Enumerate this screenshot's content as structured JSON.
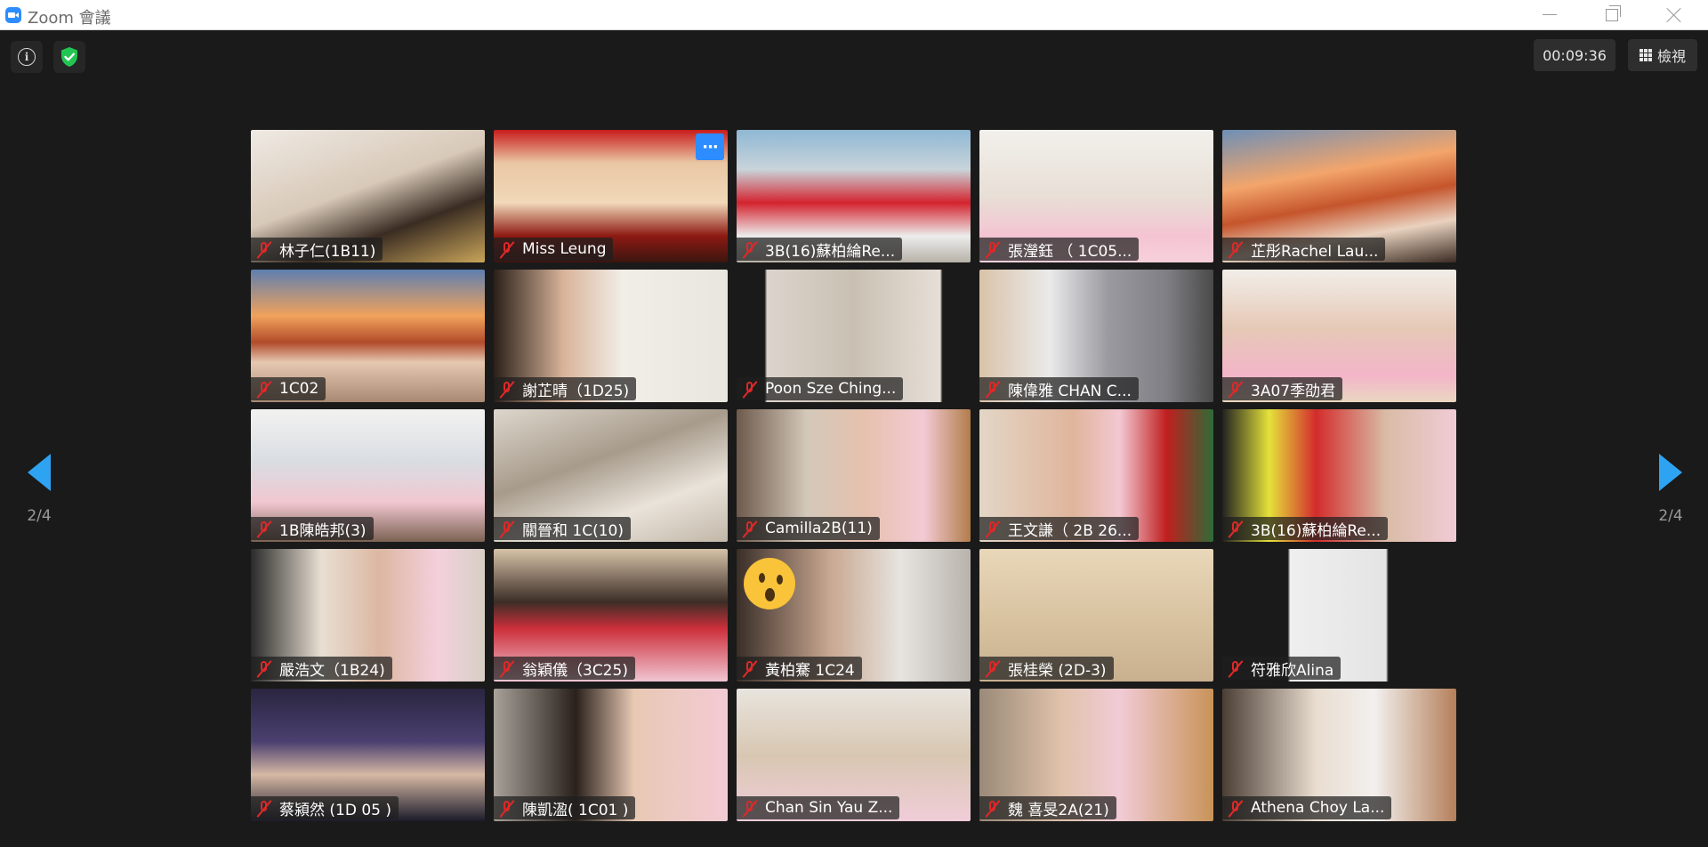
{
  "window": {
    "title": "Zoom 會議",
    "minimize_icon": "minimize-icon",
    "maximize_icon": "restore-icon",
    "close_icon": "close-icon"
  },
  "toolbar": {
    "info_icon": "info-icon",
    "security_icon": "shield-check-icon",
    "timer": "00:09:36",
    "view_label": "檢視",
    "view_icon": "grid-icon"
  },
  "pagination": {
    "left_label": "2/4",
    "right_label": "2/4"
  },
  "participants": [
    {
      "name": "林子仁(1B11)",
      "bg": "linear-gradient(160deg,#efeae4 0%,#d8c9b8 45%,#3a2c22 70%,#c9a55a 100%)",
      "muted": true
    },
    {
      "name": "Miss Leung",
      "bg": "linear-gradient(180deg,#c81c1c 0%,#e9c7a4 25%,#f1d8b8 55%,#8d1a12 80%,#3b1510 100%)",
      "muted": true,
      "more": true
    },
    {
      "name": "3B(16)蘇柏綸Re...",
      "bg": "linear-gradient(180deg,#8fb8d4 0%,#c9d4da 30%,#d3232e 55%,#ececec 80%,#b7b2a8 100%)",
      "muted": true
    },
    {
      "name": "張瀅鈺 （ 1C05...",
      "bg": "linear-gradient(180deg,#f2f0ec 0%,#e8dfd6 50%,#f4c4d2 80%,#f7d0db 100%)",
      "muted": true
    },
    {
      "name": "芷彤Rachel Lau...",
      "bg": "linear-gradient(170deg,#6e8fb6 0%,#f3a56b 35%,#c5552c 55%,#e9d2bf 75%,#3a2b22 100%)",
      "muted": true
    },
    {
      "name": "1C02",
      "bg": "linear-gradient(180deg,#5e7fb0 0%,#f1a25b 35%,#b14b2a 55%,#e6c8b1 70%,#a88973 100%)",
      "muted": true
    },
    {
      "name": "謝芷晴（1D25)",
      "bg": "linear-gradient(90deg,#2b2019 0%,#d9b49a 30%,#f1ede7 55%,#e9e5df 100%)",
      "muted": true
    },
    {
      "name": "Poon Sze Ching...",
      "bg": "linear-gradient(90deg,#1a1a1a 0%,#1a1a1a 12%,#dcd4cc 13%,#c9c0b2 50%,#e6dfd7 87%,#1a1a1a 88%,#1a1a1a 100%)",
      "muted": true
    },
    {
      "name": "陳偉雅 CHAN C...",
      "bg": "linear-gradient(90deg,#d9c3a8 0%,#eaeaea 30%,#9a9aa0 55%,#7f7f85 80%,#4a4a4a 100%)",
      "muted": true
    },
    {
      "name": "3A07季劭君",
      "bg": "linear-gradient(180deg,#f1eee8 0%,#e6c8b6 45%,#f3b5c9 80%,#ead7c0 100%)",
      "muted": true
    },
    {
      "name": "1B陳皓邦(3)",
      "bg": "linear-gradient(180deg,#f2f2f0 0%,#d9dde2 40%,#f1c7d1 70%,#7c6253 100%)",
      "muted": true
    },
    {
      "name": "關晉和 1C(10)",
      "bg": "linear-gradient(160deg,#ddd6cc 0%,#a79b8b 40%,#e9e3da 70%,#c2b7a8 100%)",
      "muted": true
    },
    {
      "name": "Camilla2B(11)",
      "bg": "linear-gradient(90deg,#6e5a4c 0%,#d3c8b9 30%,#e7c1ae 55%,#f3cad4 80%,#b27d4b 100%)",
      "muted": true
    },
    {
      "name": "王文謙（ 2B 26...",
      "bg": "linear-gradient(90deg,#e3d6c6 0%,#e0b59c 40%,#f3c8d2 60%,#c01f1f 80%,#2f6b36 100%)",
      "muted": true
    },
    {
      "name": "3B(16)蘇柏綸Re...",
      "bg": "linear-gradient(90deg,#222 0%,#e4e23a 20%,#d32c2c 40%,#d9bca6 70%,#f1cbd6 100%)",
      "muted": true
    },
    {
      "name": "嚴浩文（1B24)",
      "bg": "linear-gradient(90deg,#2a2a2a 0%,#e8dfd2 30%,#dcb7a2 55%,#f4d0dd 80%,#d7cfc4 100%)",
      "muted": true
    },
    {
      "name": "翁穎儀（3C25)",
      "bg": "linear-gradient(180deg,#d6c3a8 0%,#3c2d26 40%,#cc2f3a 60%,#f0c6d2 100%)",
      "muted": true
    },
    {
      "name": "黃柏騫 1C24",
      "bg": "linear-gradient(90deg,#3a2e28 0%,#c9a891 40%,#e7e4e0 70%,#b9b3ad 100%)",
      "muted": true,
      "emoji": "surprised-face-emoji"
    },
    {
      "name": "張桂榮 (2D-3)",
      "bg": "linear-gradient(180deg,#e8d7b9 0%,#d9c4a2 50%,#c9b08e 100%)",
      "muted": true
    },
    {
      "name": "符雅欣Alina",
      "bg": "linear-gradient(90deg,#1a1a1a 0%,#1a1a1a 28%,#efefef 29%,#e4e4e4 70%,#1a1a1a 71%,#1a1a1a 100%)",
      "muted": true
    },
    {
      "name": "蔡潁然 (1D 05 )",
      "bg": "linear-gradient(180deg,#2a2540 0%,#4a4070 40%,#d6b8a4 65%,#1b1b2a 100%)",
      "muted": true
    },
    {
      "name": "陳凱溋( 1C01 )",
      "bg": "linear-gradient(90deg,#a8a29a 0%,#2a211c 35%,#e8c9b4 60%,#f3cad4 100%)",
      "muted": true
    },
    {
      "name": "Chan Sin Yau Z...",
      "bg": "linear-gradient(180deg,#e8e4de 0%,#d8c7b2 50%,#f0cdd8 100%)",
      "muted": true
    },
    {
      "name": "魏 喜旻2A(21)",
      "bg": "linear-gradient(90deg,#9a8a78 0%,#e0c2ab 35%,#f1cbd6 60%,#c89358 100%)",
      "muted": true
    },
    {
      "name": "Athena Choy La...",
      "bg": "linear-gradient(90deg,#4b3f35 0%,#e9ddd0 40%,#f2f0ee 65%,#b57f5a 100%)",
      "muted": true
    }
  ]
}
